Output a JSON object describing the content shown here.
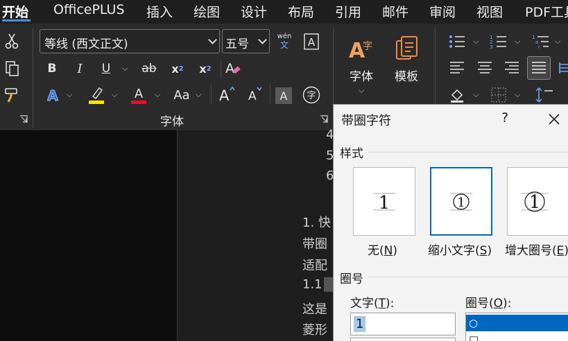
{
  "menubar": {
    "tabs": [
      "开始",
      "OfficePLUS",
      "插入",
      "绘图",
      "设计",
      "布局",
      "引用",
      "邮件",
      "审阅",
      "视图",
      "PDF工具"
    ]
  },
  "ribbon": {
    "font_name": "等线 (西文正文)",
    "font_size": "五号",
    "pinyin_top": "wén",
    "pinyin_bottom": "文",
    "font_group_label": "字体",
    "big_font_label": "字体",
    "big_template_label": "模板",
    "enclose_char": "字",
    "colors": {
      "highlight": "#ffe600",
      "font_color": "#e81123",
      "accent": "#4a90e2"
    }
  },
  "document": {
    "lines": [
      "4",
      "5",
      "6",
      "1. 快",
      "带圈",
      "适配",
      "1.1",
      "这是",
      "菱形"
    ]
  },
  "dialog": {
    "title": "带圈字符",
    "help": "?",
    "style_section": "样式",
    "styles": [
      {
        "label": "无",
        "key": "N",
        "preview": "1"
      },
      {
        "label": "缩小文字",
        "key": "S",
        "preview": "①"
      },
      {
        "label": "增大圈号",
        "key": "E",
        "preview": "①"
      }
    ],
    "enclosure_section": "圈号",
    "text_label": "文字",
    "text_key": "T",
    "enclosure_label": "圈号",
    "enclosure_key": "O",
    "text_value": "1",
    "enclosure_options": [
      "○",
      "□"
    ]
  }
}
